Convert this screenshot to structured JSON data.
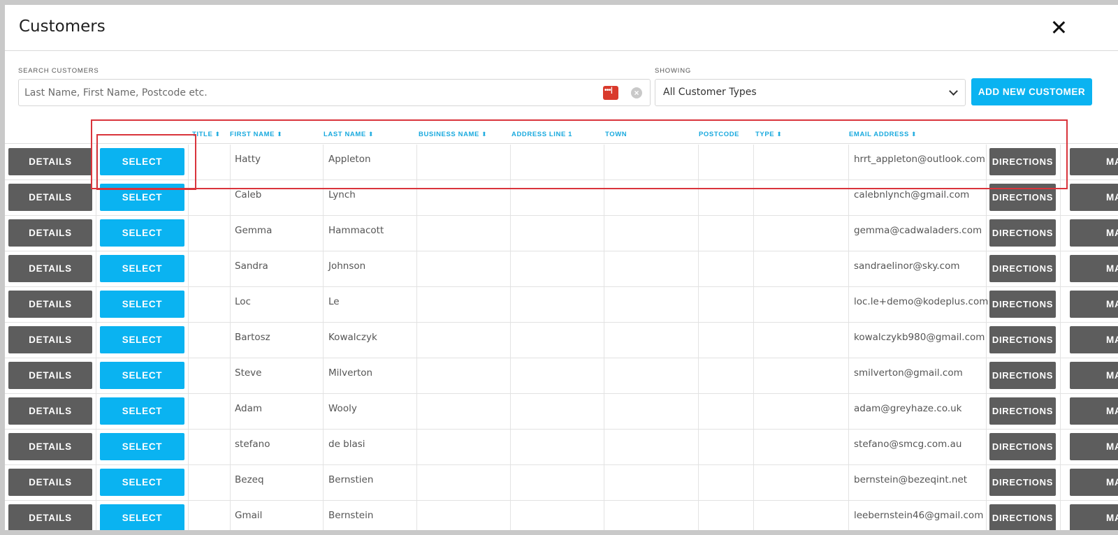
{
  "dialog": {
    "title": "Customers"
  },
  "search": {
    "label": "SEARCH CUSTOMERS",
    "placeholder": "Last Name, First Name, Postcode etc.",
    "value": ""
  },
  "filter": {
    "label": "SHOWING",
    "selected": "All Customer Types"
  },
  "add_button": {
    "label": "ADD NEW CUSTOMER"
  },
  "columns": {
    "title": "TITLE",
    "first_name": "FIRST NAME",
    "last_name": "LAST NAME",
    "business_name": "BUSINESS NAME",
    "address_line_1": "ADDRESS LINE 1",
    "town": "TOWN",
    "postcode": "POSTCODE",
    "type": "TYPE",
    "email": "EMAIL ADDRESS"
  },
  "row_buttons": {
    "details": "DETAILS",
    "select": "SELECT",
    "directions": "DIRECTIONS",
    "map": "MA"
  },
  "rows": [
    {
      "first": "Hatty",
      "last": "Appleton",
      "email": "hrrt_appleton@outlook.com"
    },
    {
      "first": "Caleb",
      "last": "Lynch",
      "email": "calebnlynch@gmail.com"
    },
    {
      "first": "Gemma",
      "last": "Hammacott",
      "email": "gemma@cadwaladers.com"
    },
    {
      "first": "Sandra",
      "last": "Johnson",
      "email": "sandraelinor@sky.com"
    },
    {
      "first": "Loc",
      "last": "Le",
      "email": "loc.le+demo@kodeplus.com"
    },
    {
      "first": "Bartosz",
      "last": "Kowalczyk",
      "email": "kowalczykb980@gmail.com"
    },
    {
      "first": "Steve",
      "last": "Milverton",
      "email": "smilverton@gmail.com"
    },
    {
      "first": "Adam",
      "last": "Wooly",
      "email": "adam@greyhaze.co.uk"
    },
    {
      "first": "stefano",
      "last": "de blasi",
      "email": "stefano@smcg.com.au"
    },
    {
      "first": "Bezeq",
      "last": "Bernstien",
      "email": "bernstein@bezeqint.net"
    },
    {
      "first": "Gmail",
      "last": "Bernstein",
      "email": "leebernstein46@gmail.com"
    }
  ],
  "colors": {
    "accent": "#0ab3f1",
    "dark_button": "#5d5d5d",
    "header_text": "#18a9de",
    "highlight": "#d9343b"
  }
}
